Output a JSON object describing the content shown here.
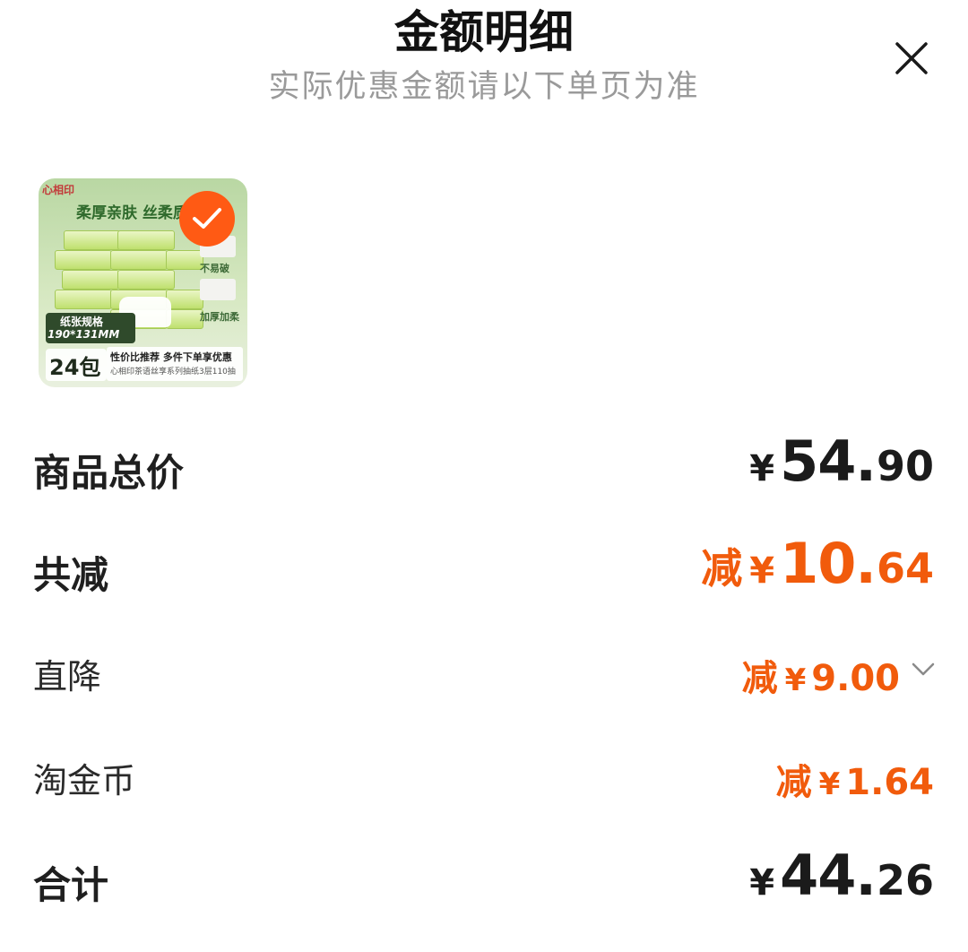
{
  "header": {
    "title": "金额明细",
    "subtitle": "实际优惠金额请以下单页为准"
  },
  "product": {
    "brand": "心相印",
    "banner_text": "柔厚亲肤  丝柔质",
    "side_label_1": "不易破",
    "side_label_2": "加厚加柔",
    "spec_title": "纸张规格",
    "spec_size": "190*131MM",
    "pack_count": "24包",
    "promo": "性价比推荐  多件下单享优惠",
    "promo_sub": "心相印茶语丝享系列抽纸3层110抽",
    "selected": true,
    "colors": {
      "badge": "#ff5a14",
      "pack": "#bfe06e"
    }
  },
  "summary": {
    "total_label": "商品总价",
    "total_currency": "¥",
    "total_int": "54",
    "total_dec": "90",
    "discount_label": "共减",
    "discount_prefix": "减",
    "discount_currency": "¥",
    "discount_int": "10",
    "discount_dec": "64",
    "direct_label": "直降",
    "direct_prefix": "减",
    "direct_currency": "¥",
    "direct_value": "9.00",
    "coin_label": "淘金币",
    "coin_prefix": "减",
    "coin_currency": "¥",
    "coin_value": "1.64",
    "sum_label": "合计",
    "sum_currency": "¥",
    "sum_int": "44",
    "sum_dec": "26"
  },
  "icons": {
    "close": "close-icon",
    "check": "check-icon",
    "chevron": "chevron-down-icon"
  },
  "colors": {
    "accent": "#f15b0c",
    "text": "#1b1b1b",
    "subtitle": "#9a9a9a"
  }
}
